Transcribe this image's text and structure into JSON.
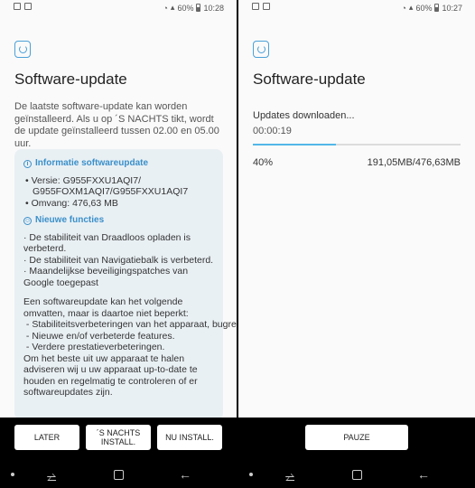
{
  "left": {
    "status": {
      "battery": "60%",
      "time": "10:28"
    },
    "title": "Software-update",
    "description": "De laatste software-update kan worden geïnstalleerd. Als u op ´S NACHTS tikt, wordt de update geïnstalleerd tussen 02.00 en 05.00 uur.",
    "info_heading": "Informatie softwareupdate",
    "version_line1": "• Versie: G955FXXU1AQI7/",
    "version_line2": "G955FOXM1AQI7/G955FXXU1AQI7",
    "size_line": "• Omvang: 476,63 MB",
    "features_heading": "Nieuwe functies",
    "features": [
      "· De stabiliteit van Draadloos opladen is verbeterd.",
      "· De stabiliteit van Navigatiebalk is verbeterd.",
      "· Maandelijkse beveiligingspatches van Google toegepast"
    ],
    "notes": [
      "Een softwareupdate kan het volgende omvatten, maar is daartoe niet beperkt:",
      " - Stabiliteitsverbeteringen van het apparaat, bugreparaties.",
      " - Nieuwe en/of verbeterde features.",
      " - Verdere prestatieverbeteringen.",
      "Om het beste uit uw apparaat te halen adviseren wij u uw apparaat up-to-date te houden en regelmatig te controleren of er softwareupdates zijn."
    ],
    "buttons": {
      "later": "LATER",
      "night_line1": "´S NACHTS",
      "night_line2": "INSTALL.",
      "now": "NU INSTALL."
    }
  },
  "right": {
    "status": {
      "battery": "60%",
      "time": "10:27"
    },
    "title": "Software-update",
    "download_status": "Updates downloaden...",
    "elapsed": "00:00:19",
    "progress_percent": 40,
    "progress_label": "40%",
    "size_progress": "191,05MB/476,63MB",
    "buttons": {
      "pause": "PAUZE"
    }
  },
  "colors": {
    "accent": "#3a8fc9",
    "progress": "#52b7e8",
    "card_bg": "#e9f0f4"
  }
}
